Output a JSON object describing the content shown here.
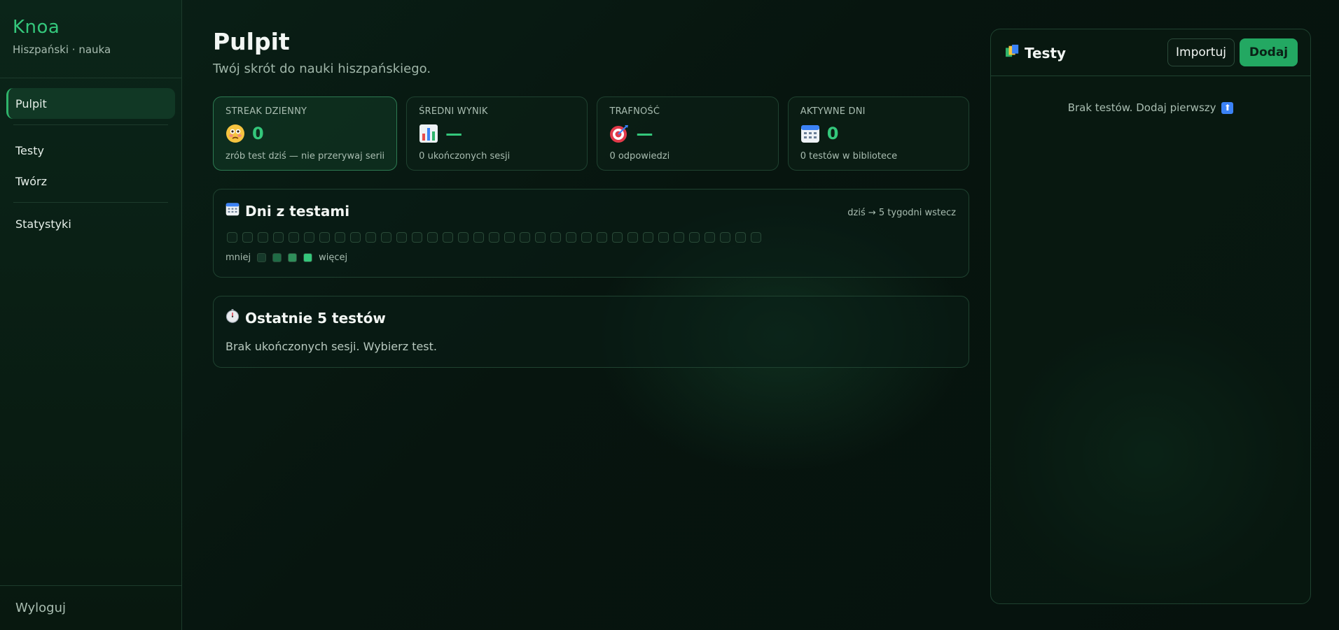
{
  "app": {
    "name": "Knoa",
    "subtitle": "Hiszpański · nauka"
  },
  "sidebar": {
    "items": [
      {
        "label": "Pulpit",
        "active": true
      },
      {
        "label": "Testy"
      },
      {
        "label": "Twórz"
      },
      {
        "label": "Statystyki"
      }
    ],
    "logout": "Wyloguj"
  },
  "page": {
    "title": "Pulpit",
    "subtitle": "Twój skrót do nauki hiszpańskiego."
  },
  "stats": [
    {
      "label": "STREAK DZIENNY",
      "icon": "flushed-face-icon",
      "value": "0",
      "caption": "zrób test dziś — nie przerywaj serii"
    },
    {
      "label": "ŚREDNI WYNIK",
      "icon": "bar-chart-icon",
      "value": "—",
      "caption": "0 ukończonych sesji"
    },
    {
      "label": "TRAFNOŚĆ",
      "icon": "target-icon",
      "value": "—",
      "caption": "0 odpowiedzi"
    },
    {
      "label": "AKTYWNE DNI",
      "icon": "calendar-icon",
      "value": "0",
      "caption": "0 testów w bibliotece"
    }
  ],
  "days_panel": {
    "title": "Dni z testami",
    "note": "dziś → 5 tygodni wstecz",
    "legend_less": "mniej",
    "legend_more": "więcej",
    "legend_colors": [
      "#16392a",
      "#1f6b45",
      "#2f8f5a",
      "#34c77b"
    ]
  },
  "recent_panel": {
    "title": "Ostatnie 5 testów",
    "empty": "Brak ukończonych sesji. Wybierz test."
  },
  "tests_panel": {
    "title": "Testy",
    "import_label": "Importuj",
    "add_label": "Dodaj",
    "empty": "Brak testów. Dodaj pierwszy"
  },
  "colors": {
    "accent": "#34c77b",
    "button": "#23a862",
    "background": "#07150f"
  }
}
